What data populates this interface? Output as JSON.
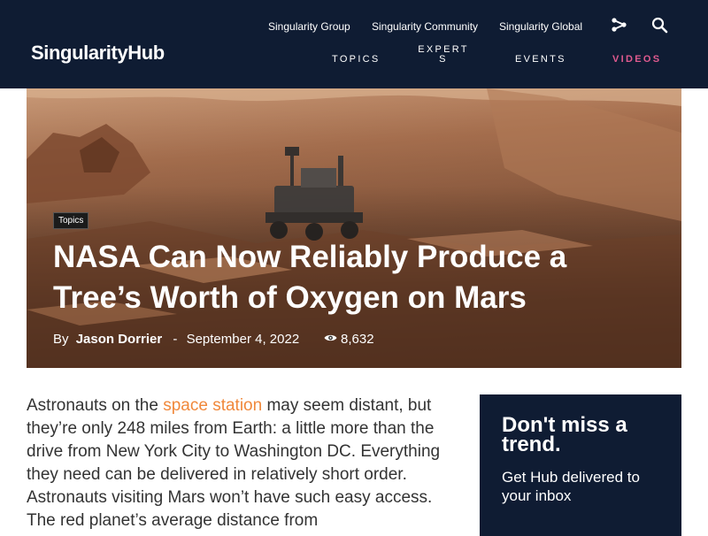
{
  "header": {
    "logo": "SingularityHub",
    "top_links": [
      "Singularity Group",
      "Singularity Community",
      "Singularity Global"
    ],
    "main_nav": [
      "TOPICS",
      "EXPERTS",
      "EVENTS",
      "VIDEOS"
    ],
    "icons": [
      "share-icon",
      "search-icon"
    ],
    "accent_color": "#e05a8f",
    "background_color": "#0f1c33"
  },
  "hero": {
    "tag": "Topics",
    "title": "NASA Can Now Reliably Produce a Tree’s Worth of Oxygen on Mars",
    "by": "By",
    "author": "Jason Dorrier",
    "separator": "-",
    "date": "September 4, 2022",
    "views": "8,632"
  },
  "article": {
    "p1_before": "Astronauts on the ",
    "p1_link": "space station",
    "p1_after": " may seem distant, but they’re only 248 miles from Earth: a little more than the drive from New York City to Washington DC. Everything they need can be delivered in relatively short order. Astronauts visiting Mars won’t have such easy access. The red planet’s average distance from",
    "link_color": "#f0883b"
  },
  "newsletter": {
    "title": "Don't miss a trend.",
    "subtitle": "Get Hub delivered to your inbox"
  }
}
